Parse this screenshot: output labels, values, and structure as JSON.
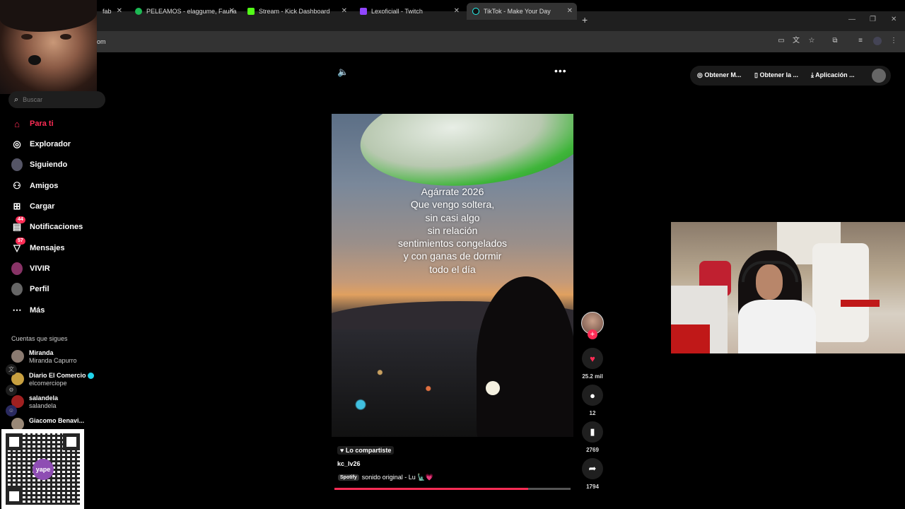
{
  "browser": {
    "tabs": [
      {
        "label": "fab",
        "active": false
      },
      {
        "label": "PELEAMOS - elaggume, Fauna",
        "active": false
      },
      {
        "label": "Stream - Kick Dashboard",
        "active": false
      },
      {
        "label": "Lexoficiall - Twitch",
        "active": false
      },
      {
        "label": "TikTok - Make Your Day",
        "active": true
      }
    ],
    "new_tab": "+",
    "address_fragment": "om",
    "tab_close": "✕",
    "win_minimize": "—",
    "win_restore": "❐",
    "win_close": "✕"
  },
  "sidebar": {
    "search_placeholder": "Buscar",
    "nav": [
      {
        "label": "Para ti",
        "icon": "home-icon",
        "active": true
      },
      {
        "label": "Explorador",
        "icon": "compass-icon"
      },
      {
        "label": "Siguiendo",
        "icon": "avatar-icon"
      },
      {
        "label": "Amigos",
        "icon": "friends-icon"
      },
      {
        "label": "Cargar",
        "icon": "upload-icon"
      },
      {
        "label": "Notificaciones",
        "icon": "notifications-icon",
        "badge": "44"
      },
      {
        "label": "Mensajes",
        "icon": "messages-icon",
        "badge": "57"
      },
      {
        "label": "VIVIR",
        "icon": "live-icon"
      },
      {
        "label": "Perfil",
        "icon": "profile-icon"
      },
      {
        "label": "Más",
        "icon": "more-icon"
      }
    ],
    "following_header": "Cuentas que sigues",
    "following": [
      {
        "name": "Miranda",
        "handle": "Miranda Capurro",
        "verified": false
      },
      {
        "name": "Diario El Comercio",
        "handle": "elcomerciope",
        "verified": true
      },
      {
        "name": "salandela",
        "handle": "salandela",
        "verified": false
      },
      {
        "name": "Giacomo Benavi...",
        "handle": "",
        "verified": false
      }
    ],
    "qr_logo": "yape"
  },
  "topbar": {
    "links": [
      "Obtener M...",
      "Obtener la ...",
      "Aplicación ..."
    ]
  },
  "video": {
    "overlay_lines": [
      "Agárrate 2026",
      "Que vengo soltera,",
      "sin casi algo",
      "sin relación",
      "sentimientos congelados",
      "y con ganas de dormir",
      "todo el día"
    ],
    "shared_label": "Lo compartiste",
    "author": "kc_lv26",
    "spotify_tag": "Spotify",
    "music": "sonido original - Lu 🗽💗",
    "progress": 0.82
  },
  "actions": {
    "likes": "25.2 mil",
    "comments": "12",
    "saves": "2769",
    "shares": "1794",
    "follow_plus": "+"
  },
  "colors": {
    "accent": "#fe2c55",
    "background": "#000000",
    "verified": "#20d5ec"
  }
}
